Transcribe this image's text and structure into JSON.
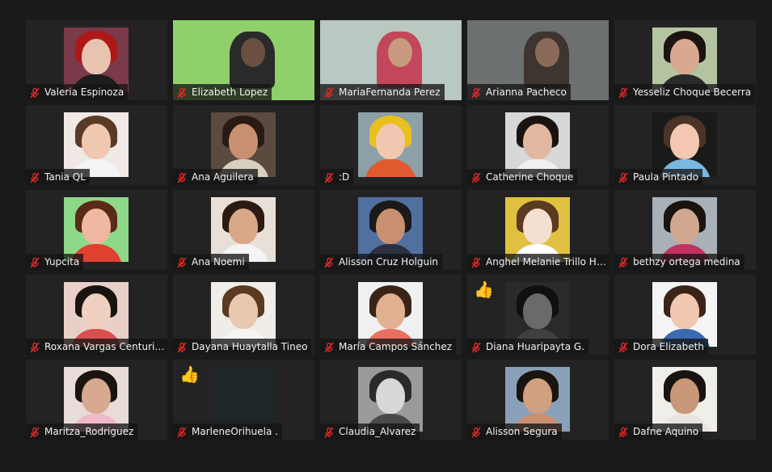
{
  "colors": {
    "background": "#1a1a1a",
    "tile": "#232323",
    "mic_muted": "#e02828",
    "name_text": "#f2f2f2"
  },
  "participants": [
    {
      "name": "Valeria Espinoza",
      "muted": true,
      "kind": "avatar",
      "bg": "#7a3a4a",
      "hair": "#b01818",
      "skin": "#e8c4b0",
      "shirt": "#1d1d1d"
    },
    {
      "name": "Elizabeth Lopez",
      "muted": true,
      "kind": "video",
      "bg": "#8fd06a",
      "shirt": "#2a2a2a",
      "skin": "#6a5040"
    },
    {
      "name": "MariaFernanda Perez",
      "muted": true,
      "kind": "video",
      "bg": "#b9c8c0",
      "shirt": "#c2475a",
      "skin": "#c89a80"
    },
    {
      "name": "Arianna Pacheco",
      "muted": true,
      "kind": "video",
      "bg": "#6c7070",
      "shirt": "#3e3430",
      "skin": "#8a6a58"
    },
    {
      "name": "Yesseliz Choque Becerra",
      "muted": true,
      "kind": "avatar",
      "bg": "#b5c4a0",
      "hair": "#1c1410",
      "skin": "#d8a890",
      "shirt": "#2a2a2a"
    },
    {
      "name": "Tania QL",
      "muted": true,
      "kind": "avatar",
      "bg": "#f0e8e4",
      "hair": "#5a3a28",
      "skin": "#f0c8b0",
      "shirt": "#f4f4f4"
    },
    {
      "name": "Ana Aguilera",
      "muted": true,
      "kind": "avatar",
      "bg": "#5a4a40",
      "hair": "#2a1a14",
      "skin": "#c89070",
      "shirt": "#d8d0c0"
    },
    {
      "name": ":D",
      "muted": true,
      "kind": "avatar",
      "bg": "#8ca0a8",
      "hair": "#e8c020",
      "skin": "#f0c8b0",
      "shirt": "#e05a30"
    },
    {
      "name": "Catherine Choque",
      "muted": true,
      "kind": "avatar",
      "bg": "#d8d8d8",
      "hair": "#1a1410",
      "skin": "#e0b8a0",
      "shirt": "#f0f0f0"
    },
    {
      "name": "Paula Pintado",
      "muted": true,
      "kind": "avatar",
      "bg": "#1a1a1a",
      "hair": "#4a3428",
      "skin": "#f4c8b0",
      "shirt": "#7ab8e0"
    },
    {
      "name": "Yupcita",
      "muted": true,
      "kind": "avatar",
      "bg": "#8ed88a",
      "hair": "#5a2a18",
      "skin": "#f0b8a0",
      "shirt": "#e04030"
    },
    {
      "name": "Ana Noemi",
      "muted": true,
      "kind": "avatar",
      "bg": "#e8e0d8",
      "hair": "#2a1a12",
      "skin": "#d8a888",
      "shirt": "#f4f4f4"
    },
    {
      "name": "Alisson Cruz Holguin",
      "muted": true,
      "kind": "avatar",
      "bg": "#5070a0",
      "hair": "#1a1a1a",
      "skin": "#c89070",
      "shirt": "#2a3040"
    },
    {
      "name": "Anghel Melanie Trillo He...",
      "muted": true,
      "kind": "avatar",
      "bg": "#e0c040",
      "hair": "#5a3a20",
      "skin": "#f4e0d0",
      "shirt": "#ffffff"
    },
    {
      "name": "bethzy ortega medina",
      "muted": true,
      "kind": "avatar",
      "bg": "#a8b0b8",
      "hair": "#1a1410",
      "skin": "#d0a890",
      "shirt": "#c03060"
    },
    {
      "name": "Roxana Vargas Centurión",
      "muted": true,
      "kind": "avatar",
      "bg": "#e8d0c8",
      "hair": "#1a1410",
      "skin": "#f0d0c0",
      "shirt": "#d85050"
    },
    {
      "name": "Dayana Huaytalla Tineo",
      "muted": true,
      "kind": "avatar",
      "bg": "#f0ece8",
      "hair": "#5a3a20",
      "skin": "#e8c8b0",
      "shirt": "#f4f4f4"
    },
    {
      "name": "María Campos Sánchez",
      "muted": true,
      "kind": "avatar",
      "bg": "#f0f0f0",
      "hair": "#3a2418",
      "skin": "#e0b090",
      "shirt": "#e87060"
    },
    {
      "name": "Diana Huaripayta G.",
      "muted": true,
      "kind": "avatar",
      "bg": "#2a2a2a",
      "hair": "#101010",
      "skin": "#6a6a6a",
      "shirt": "#404040",
      "reaction": "👍"
    },
    {
      "name": "Dora Elizabeth",
      "muted": true,
      "kind": "avatar",
      "bg": "#f4f4f4",
      "hair": "#3a2418",
      "skin": "#f0c8b0",
      "shirt": "#3a6ab0"
    },
    {
      "name": "Maritza_Rodriguez",
      "muted": true,
      "kind": "avatar",
      "bg": "#e8dcd8",
      "hair": "#1a1410",
      "skin": "#d8a890",
      "shirt": "#f0b8c8"
    },
    {
      "name": "MarleneOrihuela .",
      "muted": true,
      "kind": "blank",
      "bg": "#1e2628",
      "hair": "#1e2628",
      "skin": "#1e2628",
      "shirt": "#1e2628",
      "reaction": "👍"
    },
    {
      "name": "Claudia_Alvarez",
      "muted": true,
      "kind": "avatar",
      "bg": "#9a9a9a",
      "hair": "#2a2a2a",
      "skin": "#d8d8d8",
      "shirt": "#4a4a4a"
    },
    {
      "name": "Alisson Segura",
      "muted": true,
      "kind": "avatar",
      "bg": "#8aa0b8",
      "hair": "#1a1410",
      "skin": "#d0a080",
      "shirt": "#c89070"
    },
    {
      "name": "Dafne Aquino",
      "muted": true,
      "kind": "avatar",
      "bg": "#f0eee8",
      "hair": "#1a1410",
      "skin": "#c89878",
      "shirt": "#e8e4e0"
    }
  ]
}
